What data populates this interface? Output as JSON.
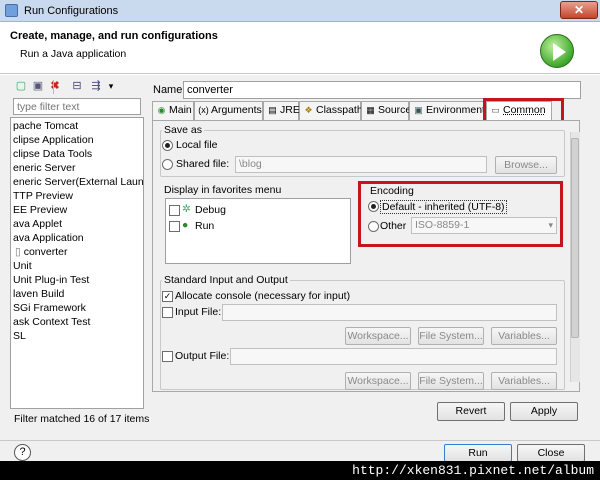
{
  "window": {
    "title": "Run Configurations",
    "close_glyph": "✕"
  },
  "header": {
    "title": "Create, manage, and run configurations",
    "subtitle": "Run a Java application"
  },
  "toolbar": {
    "icons": [
      "new-config-icon",
      "duplicate-icon",
      "delete-icon",
      "collapse-icon",
      "filter-icon"
    ],
    "dropdown_glyph": "▾"
  },
  "filter": {
    "placeholder": "type filter text"
  },
  "tree": {
    "items": [
      "pache Tomcat",
      "clipse Application",
      "clipse Data Tools",
      "eneric Server",
      "eneric Server(External Launch)",
      "TTP Preview",
      "EE Preview",
      "ava Applet",
      "ava Application",
      "converter",
      "Unit",
      "Unit Plug-in Test",
      "laven Build",
      "SGi Framework",
      "ask Context Test",
      "SL"
    ]
  },
  "filter_status": "Filter matched 16 of 17 items",
  "name": {
    "label": "Name:",
    "value": "converter"
  },
  "tabs": [
    {
      "label": "Main",
      "icon": "main-icon"
    },
    {
      "label": "Arguments",
      "icon": "arguments-icon"
    },
    {
      "label": "JRE",
      "icon": "jre-icon"
    },
    {
      "label": "Classpath",
      "icon": "classpath-icon"
    },
    {
      "label": "Source",
      "icon": "source-icon"
    },
    {
      "label": "Environment",
      "icon": "environment-icon"
    },
    {
      "label": "Common",
      "icon": "common-icon",
      "active": true
    }
  ],
  "save_as": {
    "title": "Save as",
    "local_label": "Local file",
    "shared_label": "Shared file:",
    "shared_value": "\\blog",
    "browse_label": "Browse..."
  },
  "favorites": {
    "title": "Display in favorites menu",
    "items": [
      {
        "label": "Debug",
        "icon": "debug-icon"
      },
      {
        "label": "Run",
        "icon": "run-icon"
      }
    ]
  },
  "encoding": {
    "title": "Encoding",
    "default_label": "Default - inherited (UTF-8)",
    "other_label": "Other",
    "other_value": "ISO-8859-1"
  },
  "std_io": {
    "title": "Standard Input and Output",
    "allocate_label": "Allocate console (necessary for input)",
    "input_label": "Input File:",
    "output_label": "Output File:",
    "workspace_label": "Workspace...",
    "filesystem_label": "File System...",
    "variables_label": "Variables..."
  },
  "actions": {
    "revert": "Revert",
    "apply": "Apply",
    "run": "Run",
    "close": "Close"
  },
  "help_glyph": "?",
  "watermark": "http://xken831.pixnet.net/album",
  "colors": {
    "highlight": "#c4141c",
    "accent": "#3fa82b"
  }
}
